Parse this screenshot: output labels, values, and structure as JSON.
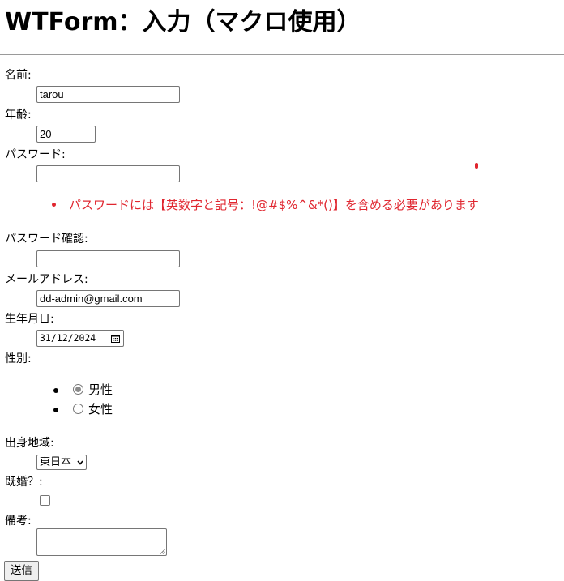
{
  "page": {
    "title": "WTForm：入力（マクロ使用）"
  },
  "form": {
    "name": {
      "label": "名前:",
      "value": "tarou"
    },
    "age": {
      "label": "年齢:",
      "value": "20"
    },
    "password": {
      "label": "パスワード:",
      "value": "",
      "errors": [
        "パスワードには【英数字と記号：!@#$%^&*()】を含める必要があります"
      ]
    },
    "password_confirm": {
      "label": "パスワード確認:",
      "value": ""
    },
    "email": {
      "label": "メールアドレス:",
      "value": "dd-admin@gmail.com"
    },
    "birthday": {
      "label": "生年月日:",
      "value": "31/12/2024"
    },
    "gender": {
      "label": "性別:",
      "options": [
        {
          "label": "男性",
          "checked": true
        },
        {
          "label": "女性",
          "checked": false
        }
      ]
    },
    "region": {
      "label": "出身地域:",
      "selected": "東日本"
    },
    "married": {
      "label": "既婚？:",
      "checked": false
    },
    "notes": {
      "label": "備考:",
      "value": ""
    },
    "submit_label": "送信"
  },
  "colors": {
    "error": "#e0262f",
    "rule": "#9a9a9a",
    "border": "#767676",
    "button_bg": "#efefef"
  },
  "icons": {
    "date_picker": "calendar-icon",
    "select_arrow": "chevron-down-icon"
  }
}
